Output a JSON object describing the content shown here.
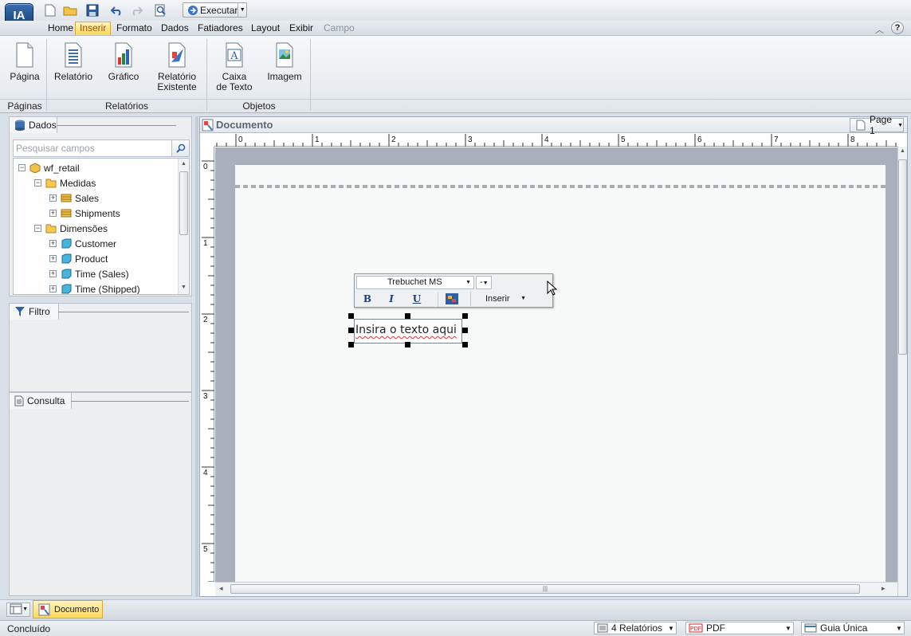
{
  "app": {
    "logo_text": "IA"
  },
  "quick_access": {
    "run_label": "Executar"
  },
  "menu": {
    "tabs": [
      "Home",
      "Inserir",
      "Formato",
      "Dados",
      "Fatiadores",
      "Layout",
      "Exibir",
      "Campo"
    ],
    "active": "Inserir"
  },
  "ribbon": {
    "buttons": {
      "page": "Página",
      "report": "Relatório",
      "chart": "Gráfico",
      "existing_1": "Relatório",
      "existing_2": "Existente",
      "textbox_1": "Caixa",
      "textbox_2": "de Texto",
      "image": "Imagem"
    },
    "groups": {
      "pages": "Páginas",
      "reports": "Relatórios",
      "objects": "Objetos"
    }
  },
  "data_panel": {
    "title": "Dados",
    "search_placeholder": "Pesquisar campos",
    "tree": {
      "root": "wf_retail",
      "measures": "Medidas",
      "sales": "Sales",
      "shipments": "Shipments",
      "dimensions": "Dimensões",
      "customer": "Customer",
      "product": "Product",
      "time_sales": "Time (Sales)",
      "time_shipped": "Time (Shipped)"
    }
  },
  "filter_panel": {
    "title": "Filtro"
  },
  "query_panel": {
    "title": "Consulta"
  },
  "document": {
    "title": "Documento",
    "page_selector": "Page 1",
    "ruler_h": [
      "0",
      "1",
      "2",
      "3",
      "4",
      "5",
      "6",
      "7",
      "8"
    ],
    "ruler_v": [
      "0",
      "1",
      "2",
      "3",
      "4",
      "5"
    ],
    "textbox_text": "Insira o texto aqui"
  },
  "mini_toolbar": {
    "font": "Trebuchet MS",
    "size": "-",
    "bold": "B",
    "italic": "I",
    "underline": "U",
    "insert": "Inserir"
  },
  "bottom_tab": {
    "label": "Documento"
  },
  "status": {
    "text": "Concluído",
    "reports": "4 Relatórios",
    "format": "PDF",
    "tab_mode": "Guia Única"
  },
  "colors": {
    "accent": "#fbd95a",
    "brand": "#1f4f8f"
  }
}
